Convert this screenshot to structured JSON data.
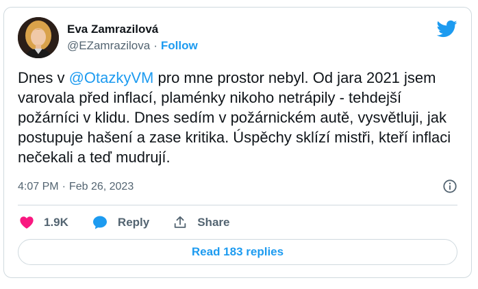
{
  "author": {
    "display_name": "Eva Zamrazilová",
    "handle": "@EZamrazilova",
    "separator": "·",
    "follow_label": "Follow"
  },
  "tweet": {
    "text_before": "Dnes v ",
    "mention": "@OtazkyVM",
    "text_after": " pro mne prostor nebyl. Od jara 2021 jsem varovala před inflací, plaménky nikoho netrápily - tehdejší požárníci v klidu. Dnes sedím v požárnickém autě, vysvětluji, jak postupuje hašení a zase kritika. Úspěchy sklízí mistři, kteří inflaci nečekali a teď mudrují."
  },
  "meta": {
    "time": "4:07 PM",
    "separator": "·",
    "date": "Feb 26, 2023"
  },
  "actions": {
    "likes": "1.9K",
    "reply_label": "Reply",
    "share_label": "Share"
  },
  "replies_button": "Read 183 replies",
  "colors": {
    "accent": "#1d9bf0",
    "heart": "#f91880",
    "text": "#0f1419",
    "muted": "#536471",
    "border": "#cfd9de"
  },
  "icons": {
    "brand": "twitter-bird-icon",
    "info": "info-icon",
    "like": "heart-icon",
    "reply": "reply-bubble-icon",
    "share": "share-icon"
  }
}
